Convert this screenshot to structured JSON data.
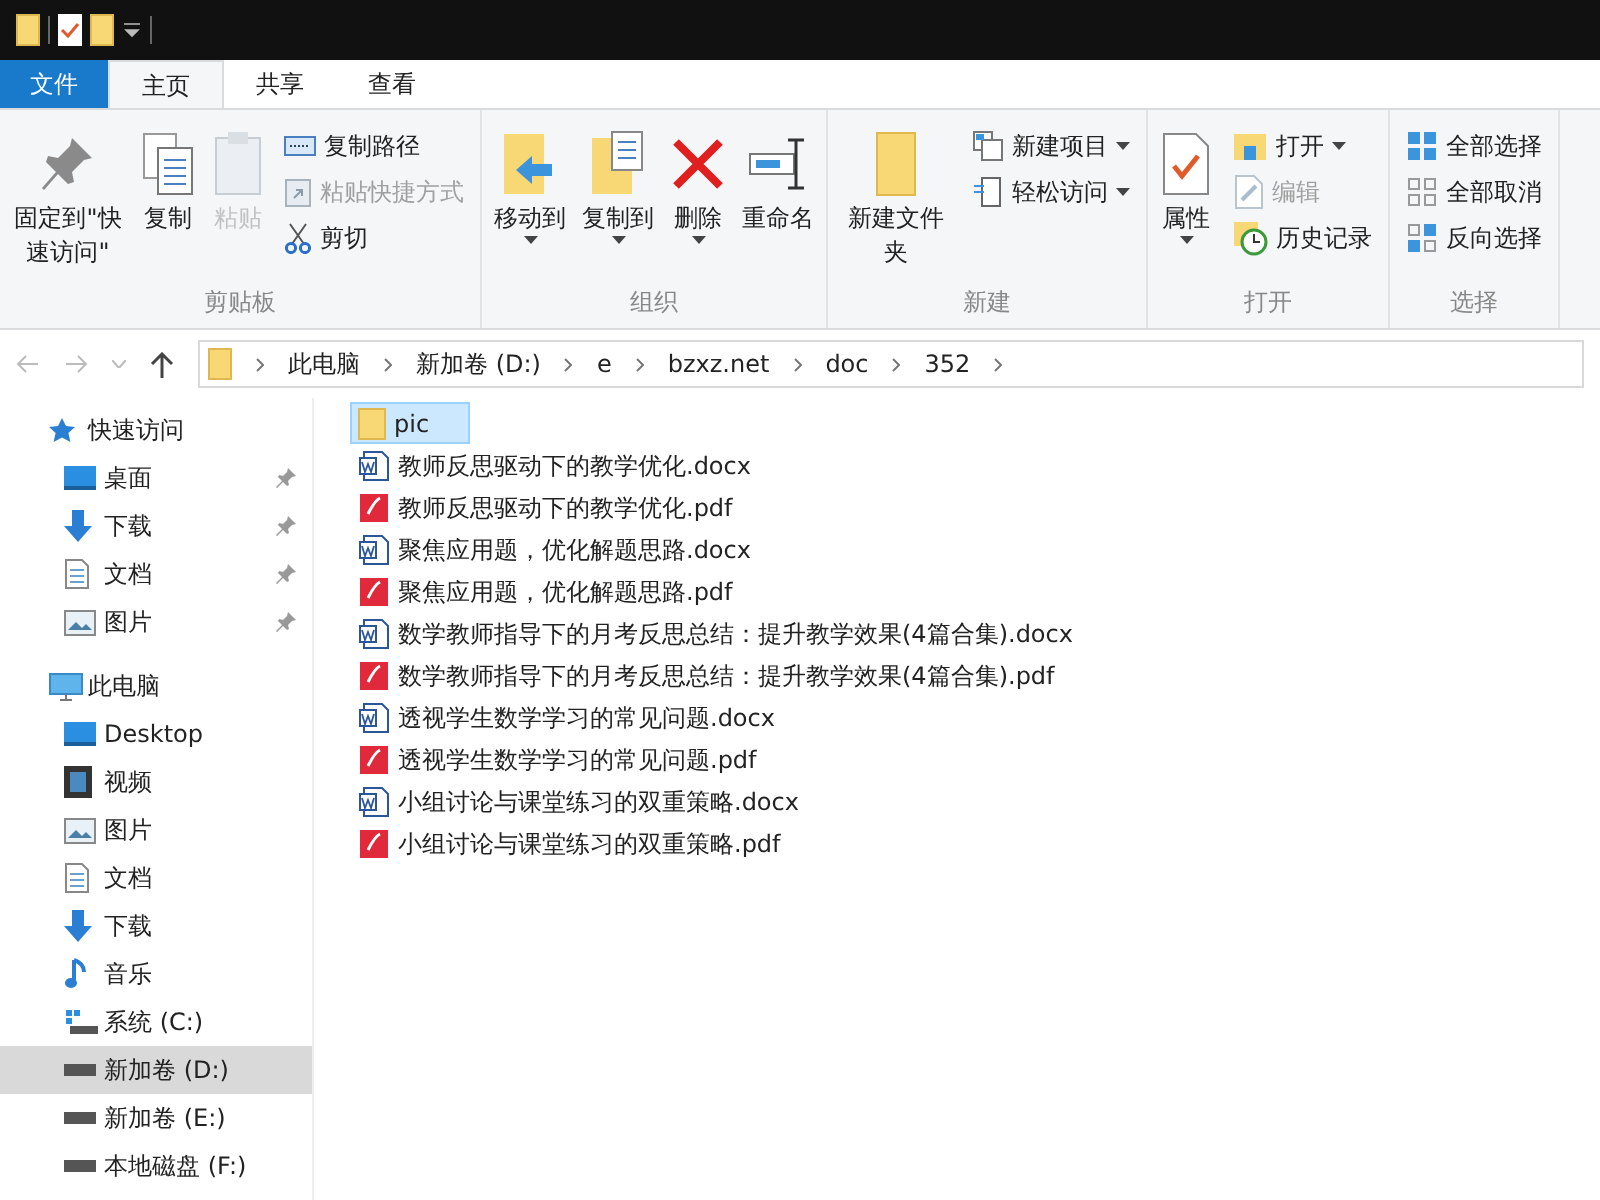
{
  "tabs": [
    {
      "label": "文件",
      "kind": "file",
      "selected": false
    },
    {
      "label": "主页",
      "kind": "tab",
      "selected": true
    },
    {
      "label": "共享",
      "kind": "tab",
      "selected": false
    },
    {
      "label": "查看",
      "kind": "tab",
      "selected": false
    }
  ],
  "ribbon": [
    {
      "label": "剪贴板",
      "items": [
        {
          "label": "固定到\"快速访问\"",
          "kind": "large",
          "disabled": false,
          "dropdown": false
        },
        {
          "label": "复制",
          "kind": "large",
          "disabled": false,
          "dropdown": false
        },
        {
          "label": "粘贴",
          "kind": "large",
          "disabled": true,
          "dropdown": false
        },
        {
          "label": "复制路径",
          "kind": "small",
          "disabled": false,
          "dropdown": false
        },
        {
          "label": "粘贴快捷方式",
          "kind": "small",
          "disabled": true,
          "dropdown": false
        },
        {
          "label": "剪切",
          "kind": "small",
          "disabled": false,
          "dropdown": false
        }
      ]
    },
    {
      "label": "组织",
      "items": [
        {
          "label": "移动到",
          "kind": "large",
          "disabled": false,
          "dropdown": true
        },
        {
          "label": "复制到",
          "kind": "large",
          "disabled": false,
          "dropdown": true
        },
        {
          "label": "删除",
          "kind": "large",
          "disabled": false,
          "dropdown": true
        },
        {
          "label": "重命名",
          "kind": "large",
          "disabled": false,
          "dropdown": false
        }
      ]
    },
    {
      "label": "新建",
      "items": [
        {
          "label": "新建文件夹",
          "kind": "large",
          "disabled": false,
          "dropdown": false
        },
        {
          "label": "新建项目",
          "kind": "small",
          "disabled": false,
          "dropdown": true
        },
        {
          "label": "轻松访问",
          "kind": "small",
          "disabled": false,
          "dropdown": true
        }
      ]
    },
    {
      "label": "打开",
      "items": [
        {
          "label": "属性",
          "kind": "large",
          "disabled": false,
          "dropdown": true
        },
        {
          "label": "打开",
          "kind": "small",
          "disabled": false,
          "dropdown": true
        },
        {
          "label": "编辑",
          "kind": "small",
          "disabled": true,
          "dropdown": false
        },
        {
          "label": "历史记录",
          "kind": "small",
          "disabled": false,
          "dropdown": false
        }
      ]
    },
    {
      "label": "选择",
      "items": [
        {
          "label": "全部选择",
          "kind": "small",
          "disabled": false,
          "dropdown": false
        },
        {
          "label": "全部取消",
          "kind": "small",
          "disabled": false,
          "dropdown": false
        },
        {
          "label": "反向选择",
          "kind": "small",
          "disabled": false,
          "dropdown": false
        }
      ]
    }
  ],
  "address": {
    "crumbs": [
      "此电脑",
      "新加卷 (D:)",
      "e",
      "bzxz.net",
      "doc",
      "352"
    ]
  },
  "sidebar": [
    {
      "label": "快速访问",
      "kind": "star",
      "selected": false,
      "children": [
        {
          "label": "桌面",
          "kind": "desktop",
          "pinned": true,
          "selected": false
        },
        {
          "label": "下载",
          "kind": "downloads",
          "pinned": true,
          "selected": false
        },
        {
          "label": "文档",
          "kind": "documents",
          "pinned": true,
          "selected": false
        },
        {
          "label": "图片",
          "kind": "pictures",
          "pinned": true,
          "selected": false
        }
      ]
    },
    {
      "label": "此电脑",
      "kind": "computer",
      "selected": false,
      "children": [
        {
          "label": "Desktop",
          "kind": "desktop",
          "pinned": false,
          "selected": false
        },
        {
          "label": "视频",
          "kind": "videos",
          "pinned": false,
          "selected": false
        },
        {
          "label": "图片",
          "kind": "pictures",
          "pinned": false,
          "selected": false
        },
        {
          "label": "文档",
          "kind": "documents",
          "pinned": false,
          "selected": false
        },
        {
          "label": "下载",
          "kind": "downloads",
          "pinned": false,
          "selected": false
        },
        {
          "label": "音乐",
          "kind": "music",
          "pinned": false,
          "selected": false
        },
        {
          "label": "系统 (C:)",
          "kind": "system-drive",
          "pinned": false,
          "selected": false
        },
        {
          "label": "新加卷 (D:)",
          "kind": "drive",
          "pinned": false,
          "selected": true
        },
        {
          "label": "新加卷 (E:)",
          "kind": "drive",
          "pinned": false,
          "selected": false
        },
        {
          "label": "本地磁盘 (F:)",
          "kind": "drive",
          "pinned": false,
          "selected": false
        }
      ]
    }
  ],
  "files": [
    {
      "name": "pic",
      "kind": "folder",
      "selected": true
    },
    {
      "name": "教师反思驱动下的教学优化.docx",
      "kind": "docx",
      "selected": false
    },
    {
      "name": "教师反思驱动下的教学优化.pdf",
      "kind": "pdf",
      "selected": false
    },
    {
      "name": "聚焦应用题，优化解题思路.docx",
      "kind": "docx",
      "selected": false
    },
    {
      "name": "聚焦应用题，优化解题思路.pdf",
      "kind": "pdf",
      "selected": false
    },
    {
      "name": "数学教师指导下的月考反思总结：提升教学效果(4篇合集).docx",
      "kind": "docx",
      "selected": false
    },
    {
      "name": "数学教师指导下的月考反思总结：提升教学效果(4篇合集).pdf",
      "kind": "pdf",
      "selected": false
    },
    {
      "name": "透视学生数学学习的常见问题.docx",
      "kind": "docx",
      "selected": false
    },
    {
      "name": "透视学生数学学习的常见问题.pdf",
      "kind": "pdf",
      "selected": false
    },
    {
      "name": "小组讨论与课堂练习的双重策略.docx",
      "kind": "docx",
      "selected": false
    },
    {
      "name": "小组讨论与课堂练习的双重策略.pdf",
      "kind": "pdf",
      "selected": false
    }
  ]
}
